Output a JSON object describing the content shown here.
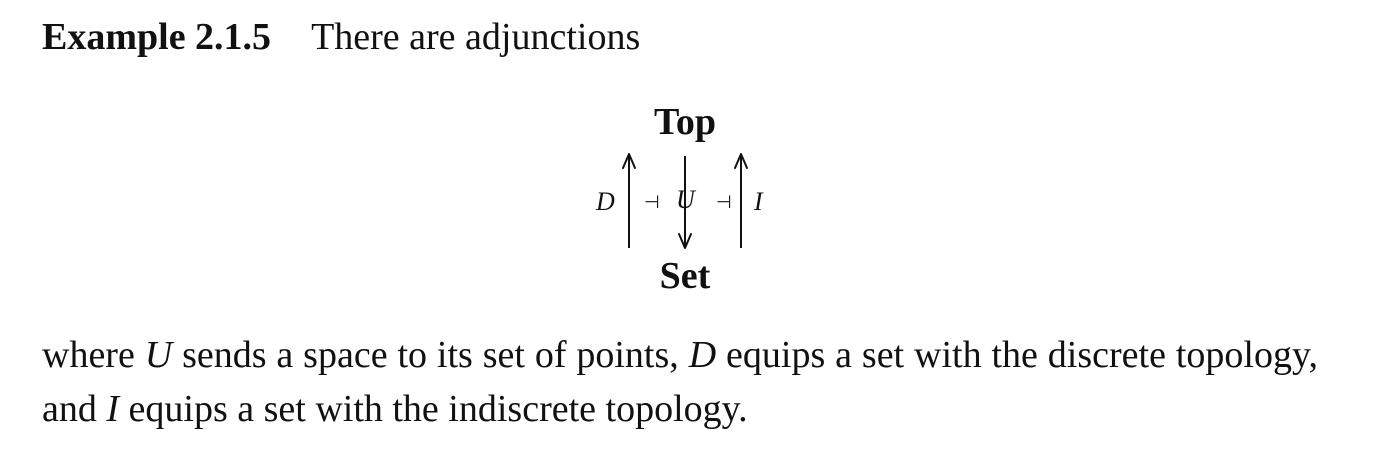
{
  "example": {
    "label": "Example 2.1.5",
    "intro": "There are adjunctions"
  },
  "diagram": {
    "top_object": "Top",
    "bottom_object": "Set",
    "functors": {
      "left": "D",
      "middle": "U",
      "right": "I"
    },
    "adjoint_symbol": "⊣"
  },
  "paragraph": {
    "seg1": "where ",
    "U": "U",
    "seg2": " sends a space to its set of points, ",
    "D": "D",
    "seg3": " equips a set with the discrete topology, and ",
    "I": "I",
    "seg4": " equips a set with the indiscrete topology."
  }
}
